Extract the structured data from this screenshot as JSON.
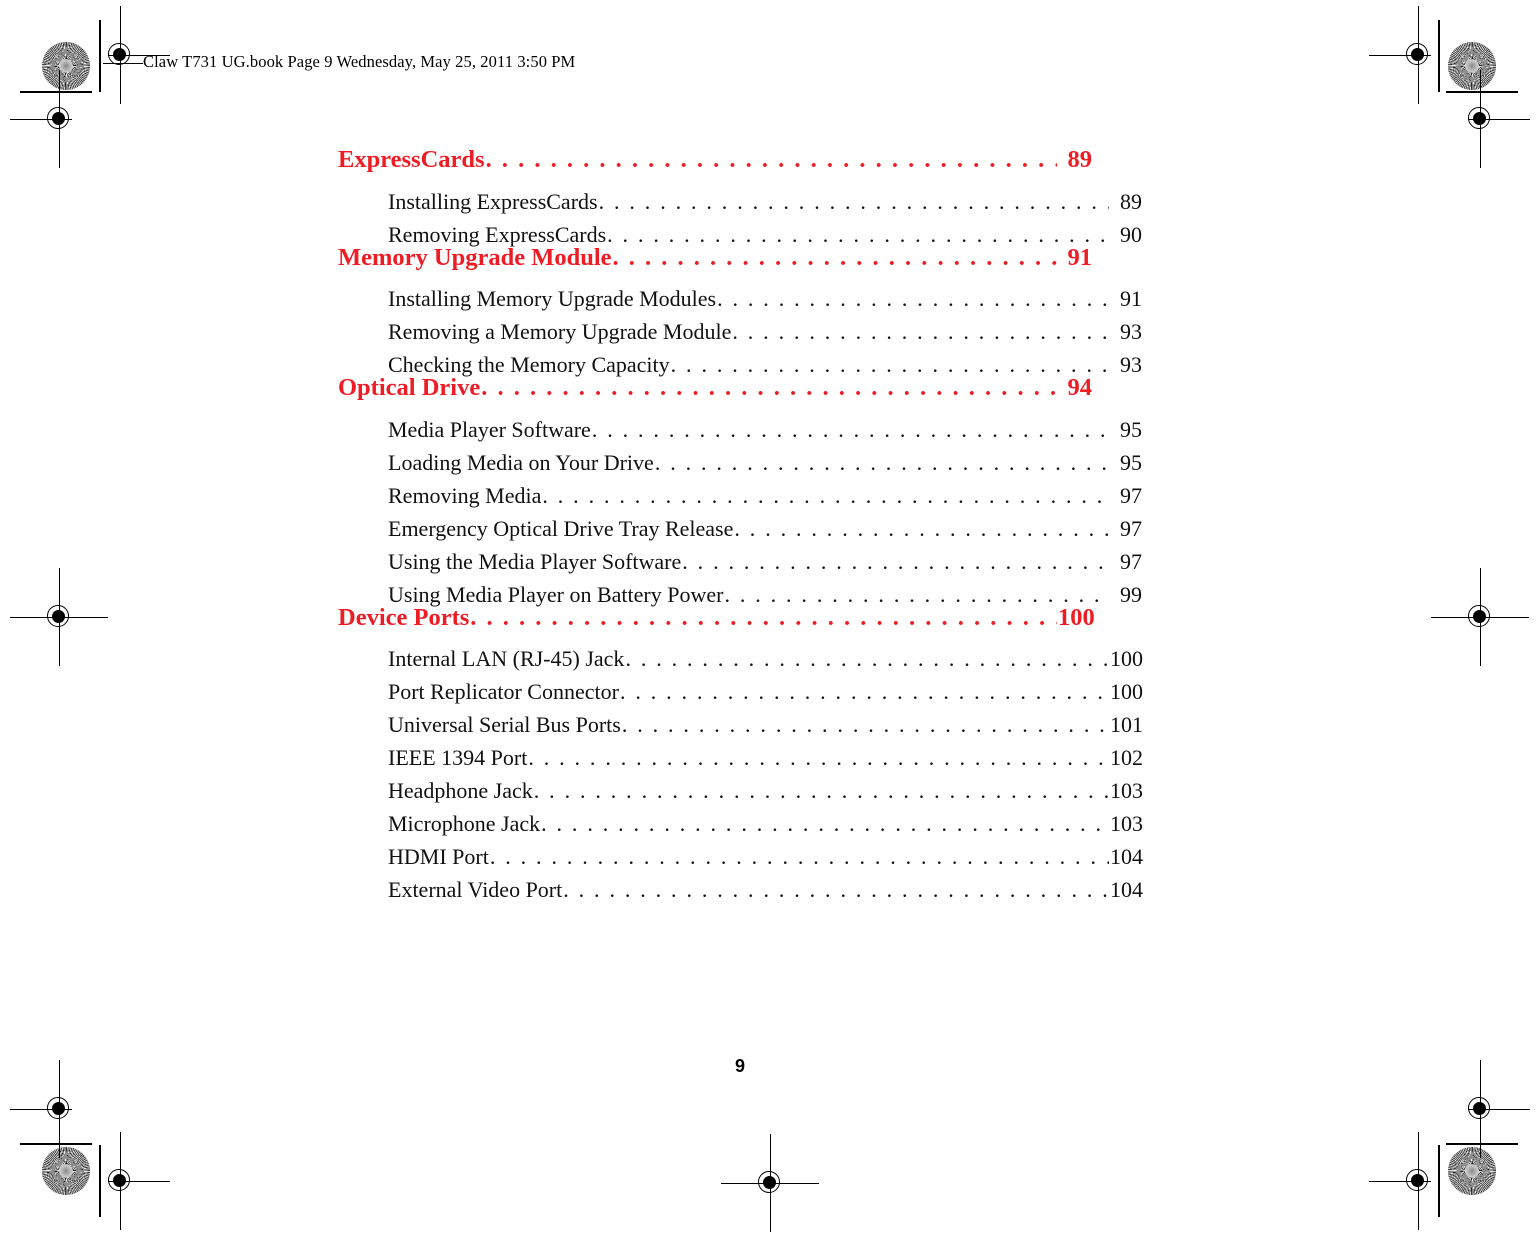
{
  "document": {
    "running_header": "Claw T731 UG.book  Page 9  Wednesday, May 25, 2011  3:50 PM",
    "folio": "9",
    "accent_color": "#ee1c25",
    "text_color": "#000000"
  },
  "toc": {
    "leader_dots": ". . . . . . . . . . . . . . . . . . . . . . . . . . . . . . . . . . . . . . . . . . . . . . . . . . . . . . . . . . . . . . . . . . . . . . . . . . . . . . . . . . . . . . . . . . . . . . . . . . . . . . . . . . . . . . . . . . . . . .",
    "sections": [
      {
        "title": "ExpressCards",
        "page": "89",
        "entries": [
          {
            "title": "Installing ExpressCards",
            "page": "89"
          },
          {
            "title": "Removing ExpressCards",
            "page": "90"
          }
        ]
      },
      {
        "title": "Memory Upgrade Module",
        "page": "91",
        "entries": [
          {
            "title": "Installing Memory Upgrade Modules",
            "page": "91"
          },
          {
            "title": "Removing a Memory Upgrade Module",
            "page": "93"
          },
          {
            "title": "Checking the Memory Capacity",
            "page": "93"
          }
        ]
      },
      {
        "title": "Optical Drive",
        "page": "94",
        "entries": [
          {
            "title": "Media Player Software",
            "page": "95"
          },
          {
            "title": "Loading Media on Your Drive",
            "page": "95"
          },
          {
            "title": "Removing Media",
            "page": "97"
          },
          {
            "title": "Emergency Optical Drive Tray Release",
            "page": "97"
          },
          {
            "title": "Using the Media Player Software",
            "page": "97"
          },
          {
            "title": "Using Media Player on Battery Power",
            "page": "99"
          }
        ]
      },
      {
        "title": "Device Ports",
        "page": "100",
        "entries": [
          {
            "title": "Internal LAN (RJ-45) Jack",
            "page": "100"
          },
          {
            "title": "Port Replicator Connector",
            "page": "100"
          },
          {
            "title": "Universal Serial Bus Ports",
            "page": "101"
          },
          {
            "title": "IEEE 1394 Port",
            "page": "102"
          },
          {
            "title": "Headphone Jack",
            "page": "103"
          },
          {
            "title": "Microphone Jack",
            "page": "103"
          },
          {
            "title": "HDMI Port",
            "page": "104"
          },
          {
            "title": "External Video Port",
            "page": "104"
          }
        ]
      }
    ]
  },
  "print_marks": {
    "registration_icon": "registration-target-icon",
    "rosette_icon": "color-rosette-icon",
    "trim_icon": "trim-line"
  }
}
